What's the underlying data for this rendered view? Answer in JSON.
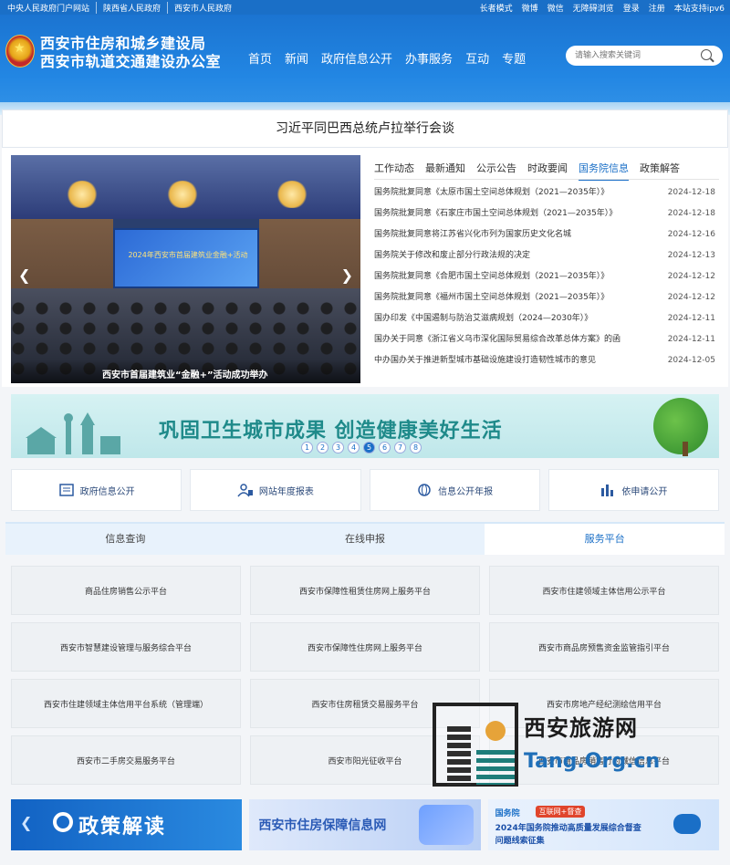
{
  "topbar": {
    "left_links": [
      "中央人民政府门户网站",
      "陕西省人民政府",
      "西安市人民政府"
    ],
    "right_links": [
      "长者模式",
      "微博",
      "微信",
      "无障碍浏览",
      "登录",
      "注册",
      "本站支持ipv6"
    ]
  },
  "header": {
    "org_line1": "西安市住房和城乡建设局",
    "org_line2": "西安市轨道交通建设办公室",
    "nav": [
      "首页",
      "新闻",
      "政府信息公开",
      "办事服务",
      "互动",
      "专题"
    ],
    "search_placeholder": "请输入搜索关键词"
  },
  "headline": "习近平同巴西总统卢拉举行会谈",
  "carousel": {
    "screen_text": "2024年西安市首届建筑业金融+活动",
    "caption": "西安市首届建筑业“金融+”活动成功举办"
  },
  "news": {
    "tabs": [
      "工作动态",
      "最新通知",
      "公示公告",
      "时政要闻",
      "国务院信息",
      "政策解答"
    ],
    "active_tab": "国务院信息",
    "items": [
      {
        "title": "国务院批复同意《太原市国土空间总体规划（2021—2035年）》",
        "date": "2024-12-18"
      },
      {
        "title": "国务院批复同意《石家庄市国土空间总体规划（2021—2035年）》",
        "date": "2024-12-18"
      },
      {
        "title": "国务院批复同意将江苏省兴化市列为国家历史文化名城",
        "date": "2024-12-16"
      },
      {
        "title": "国务院关于修改和废止部分行政法规的决定",
        "date": "2024-12-13"
      },
      {
        "title": "国务院批复同意《合肥市国土空间总体规划（2021—2035年）》",
        "date": "2024-12-12"
      },
      {
        "title": "国务院批复同意《福州市国土空间总体规划（2021—2035年）》",
        "date": "2024-12-12"
      },
      {
        "title": "国办印发《中国遏制与防治艾滋病规划（2024—2030年）》",
        "date": "2024-12-11"
      },
      {
        "title": "国办关于同意《浙江省义乌市深化国际贸易综合改革总体方案》的函",
        "date": "2024-12-11"
      },
      {
        "title": "中办国办关于推进新型城市基础设施建设打造韧性城市的意见",
        "date": "2024-12-05"
      }
    ]
  },
  "banner": {
    "slogan": "巩固卫生城市成果  创造健康美好生活",
    "pages": [
      "1",
      "2",
      "3",
      "4",
      "5",
      "6",
      "7",
      "8"
    ],
    "active_page": "5"
  },
  "quick_links": [
    {
      "label": "政府信息公开",
      "icon": "document-icon"
    },
    {
      "label": "网站年度报表",
      "icon": "report-user-icon"
    },
    {
      "label": "信息公开年报",
      "icon": "globe-icon"
    },
    {
      "label": "依申请公开",
      "icon": "bar-chart-icon"
    }
  ],
  "service_tabs": [
    "信息查询",
    "在线申报",
    "服务平台"
  ],
  "service_active": "服务平台",
  "services": [
    "商品住房销售公示平台",
    "西安市保障性租赁住房网上服务平台",
    "西安市住建领域主体信用公示平台",
    "西安市智慧建设管理与服务综合平台",
    "西安市保障性住房网上服务平台",
    "西安市商品房预售资金监管指引平台",
    "西安市住建领域主体信用平台系统（管理端）",
    "西安市住房租赁交易服务平台",
    "西安市房地产经纪测绘信用平台",
    "西安市二手房交易服务平台",
    "西安市阳光征收平台",
    "西安市商品房销售行为诚信信息平台"
  ],
  "bottom_banners": {
    "policy": "政策解读",
    "housing": "西安市住房保障信息网",
    "gov_brand": "国务院",
    "gov_tag": "互联网+督查",
    "gov_line1": "2024年国务院推动高质量发展综合督查",
    "gov_line2": "问题线索征集"
  },
  "watermark": {
    "cn": "西安旅游网",
    "en": "Tang.Org.cn"
  },
  "colors": {
    "primary": "#1a6fc7",
    "banner_text": "#1f8a8a"
  }
}
